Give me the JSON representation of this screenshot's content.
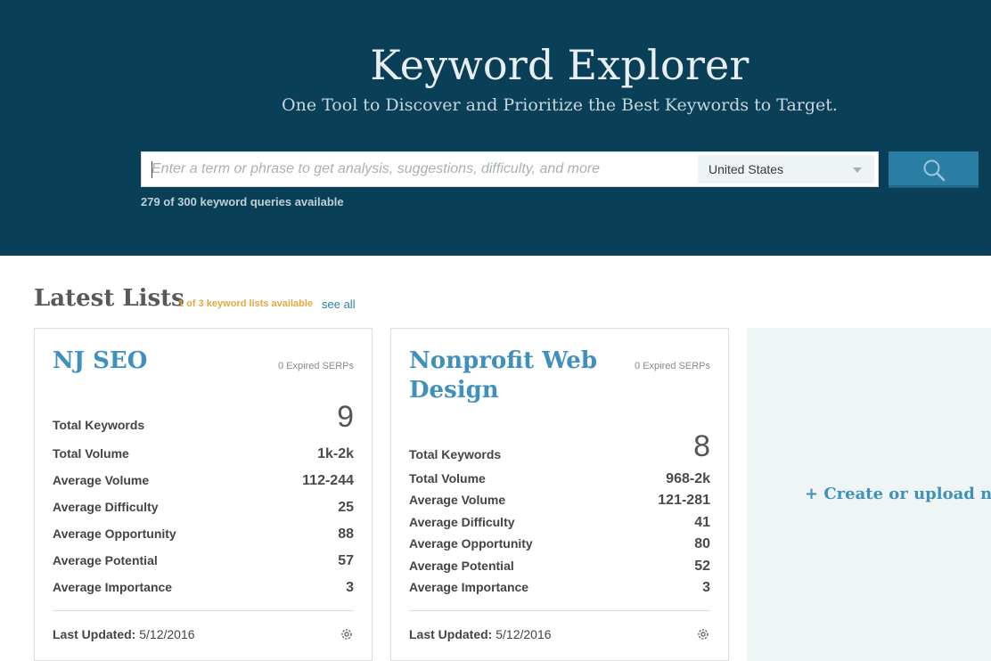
{
  "hero": {
    "title": "Keyword Explorer",
    "subtitle": "One Tool to Discover and Prioritize the Best Keywords to Target.",
    "search_placeholder": "Enter a term or phrase to get analysis, suggestions, difficulty, and more",
    "search_value": "",
    "country": "United States",
    "search_icon": "search-icon",
    "quota": "279 of 300 keyword queries available"
  },
  "lists": {
    "title": "Latest Lists",
    "available": "1 of 3 keyword lists available",
    "see_all": "see all",
    "cards": [
      {
        "title": "NJ SEO",
        "expired": "0 Expired SERPs",
        "total_keywords_label": "Total Keywords",
        "total_keywords": "9",
        "rows": [
          {
            "label": "Total Volume",
            "value": "1k-2k"
          },
          {
            "label": "Average Volume",
            "value": "112-244"
          },
          {
            "label": "Average Difficulty",
            "value": "25"
          },
          {
            "label": "Average Opportunity",
            "value": "88"
          },
          {
            "label": "Average Potential",
            "value": "57"
          },
          {
            "label": "Average Importance",
            "value": "3"
          }
        ],
        "updated_label": "Last Updated:",
        "updated_value": "5/12/2016"
      },
      {
        "title": "Nonprofit Web Design",
        "expired": "0 Expired SERPs",
        "total_keywords_label": "Total Keywords",
        "total_keywords": "8",
        "rows": [
          {
            "label": "Total Volume",
            "value": "968-2k"
          },
          {
            "label": "Average Volume",
            "value": "121-281"
          },
          {
            "label": "Average Difficulty",
            "value": "41"
          },
          {
            "label": "Average Opportunity",
            "value": "80"
          },
          {
            "label": "Average Potential",
            "value": "52"
          },
          {
            "label": "Average Importance",
            "value": "3"
          }
        ],
        "updated_label": "Last Updated:",
        "updated_value": "5/12/2016"
      }
    ],
    "create_label": "+ Create or upload new"
  },
  "colors": {
    "header_bg": "#093f57",
    "accent_blue": "#3f90bd",
    "button_blue": "#2a7da3",
    "orange": "#e3a944"
  }
}
